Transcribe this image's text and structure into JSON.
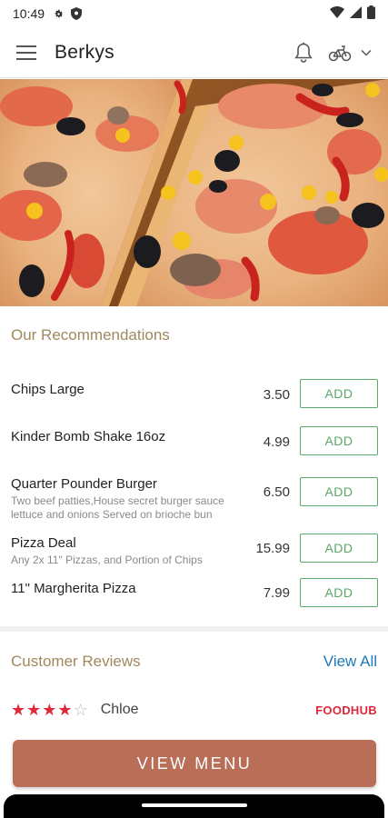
{
  "status_bar": {
    "time": "10:49",
    "icons": [
      "gear-icon",
      "shield-icon",
      "wifi-icon",
      "signal-icon",
      "battery-icon"
    ]
  },
  "app_bar": {
    "title": "Berkys",
    "menu_icon": "hamburger-icon",
    "notification_icon": "bell-icon",
    "order_type_icon": "bicycle-icon",
    "dropdown_icon": "chevron-down-icon"
  },
  "hero": {
    "image": "pizza-photo"
  },
  "recommendations": {
    "title": "Our Recommendations",
    "items": [
      {
        "name": "Chips Large",
        "description": "",
        "price": "3.50",
        "button": "ADD"
      },
      {
        "name": "Kinder Bomb Shake 16oz",
        "description": "",
        "price": "4.99",
        "button": "ADD"
      },
      {
        "name": "Quarter Pounder Burger",
        "description": "Two beef patties,House secret burger sauce lettuce and onions Served on brioche bun",
        "price": "6.50",
        "button": "ADD"
      },
      {
        "name": "Pizza Deal",
        "description": "Any 2x 11\" Pizzas, and Portion of Chips",
        "price": "15.99",
        "button": "ADD"
      },
      {
        "name": "11\" Margherita Pizza",
        "description": "",
        "price": "7.99",
        "button": "ADD"
      }
    ]
  },
  "reviews": {
    "title": "Customer Reviews",
    "view_all": "View All",
    "review": {
      "rating": 4,
      "max_rating": 5,
      "reviewer": "Chloe",
      "source": "FOODHUB"
    }
  },
  "cta": {
    "label": "VIEW MENU"
  },
  "colors": {
    "accent": "#b86e57",
    "section_title": "#a0895f",
    "add_button": "#5aa86a",
    "link": "#1d7ab8",
    "star": "#e0283a",
    "foodhub": "#e0283a"
  }
}
